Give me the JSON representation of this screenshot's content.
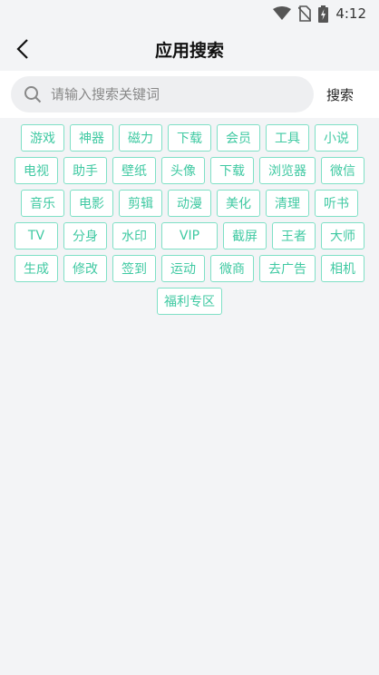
{
  "status_bar": {
    "time": "4:12",
    "icons": [
      "wifi-icon",
      "no-sim-icon",
      "battery-charging-icon"
    ]
  },
  "header": {
    "back_icon": "chevron-left-icon",
    "title": "应用搜索"
  },
  "search": {
    "icon": "search-icon",
    "placeholder": "请输入搜索关键词",
    "value": "",
    "button_label": "搜索"
  },
  "colors": {
    "accent": "#3fc9a2",
    "tag_border": "#7fe0c6",
    "background": "#f3f4f6"
  },
  "tag_rows": [
    [
      "游戏",
      "神器",
      "磁力",
      "下载",
      "会员",
      "工具",
      "小说"
    ],
    [
      "电视",
      "助手",
      "壁纸",
      "头像",
      "下载",
      "浏览器",
      "微信"
    ],
    [
      "音乐",
      "电影",
      "剪辑",
      "动漫",
      "美化",
      "清理",
      "听书"
    ],
    [
      "TV",
      "分身",
      "水印",
      "VIP",
      "截屏",
      "王者",
      "大师"
    ],
    [
      "生成",
      "修改",
      "签到",
      "运动",
      "微商",
      "去广告",
      "相机"
    ],
    [
      "福利专区"
    ]
  ]
}
